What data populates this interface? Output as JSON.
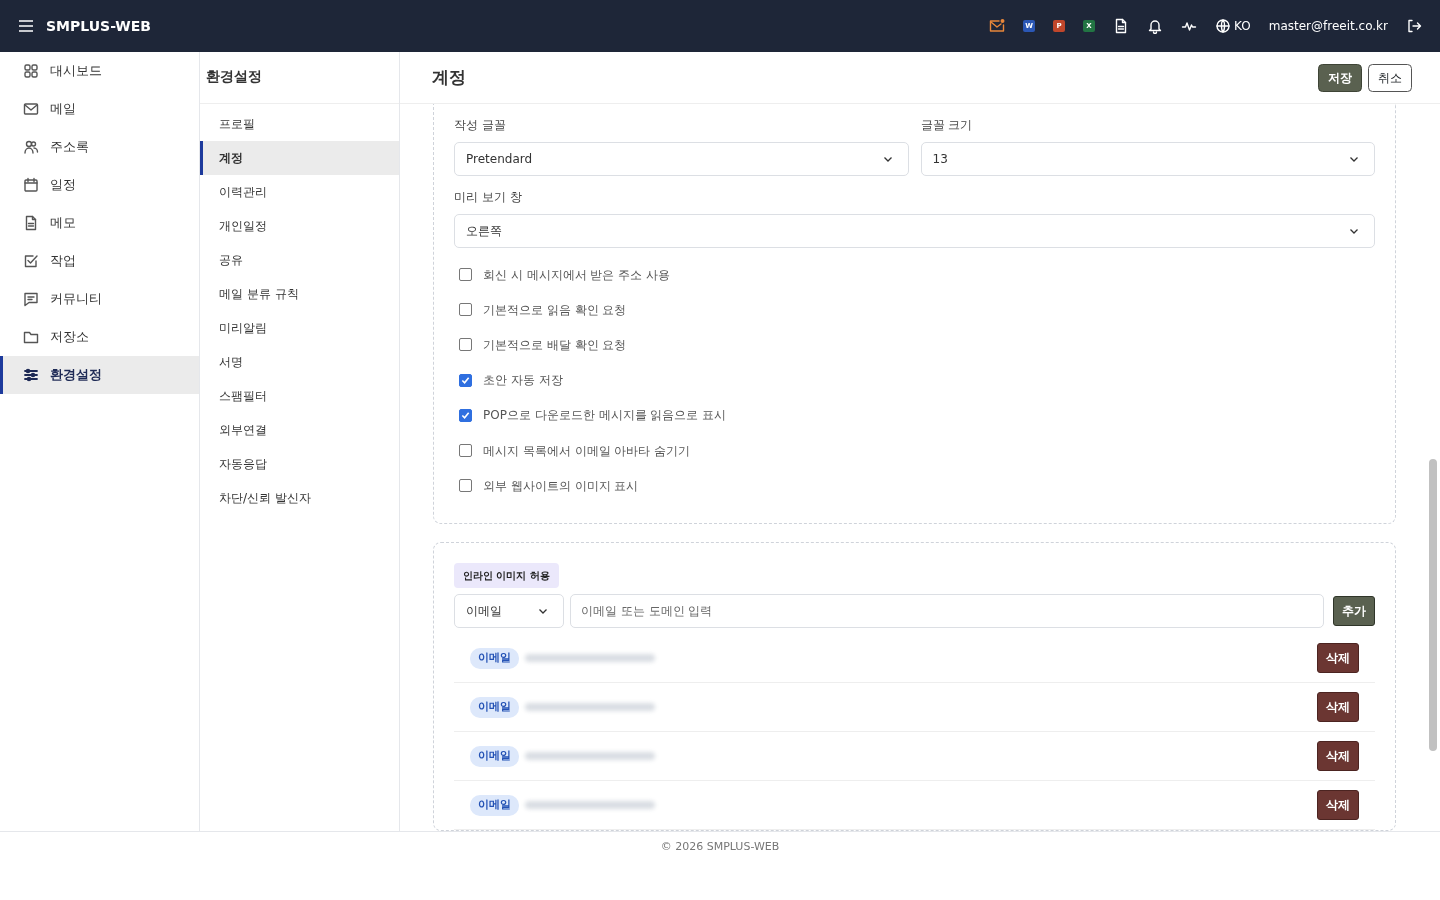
{
  "topbar": {
    "brand": "SMPLUS-WEB",
    "language": "KO",
    "user": "master@freeit.co.kr",
    "app_icons": [
      {
        "kind": "mail"
      },
      {
        "kind": "word",
        "letter": "W"
      },
      {
        "kind": "powerpoint",
        "letter": "P"
      },
      {
        "kind": "excel",
        "letter": "X"
      },
      {
        "kind": "document"
      },
      {
        "kind": "bell"
      },
      {
        "kind": "pulse"
      }
    ]
  },
  "sidebar": {
    "items": [
      {
        "label": "대시보드",
        "kind": "grid",
        "selected": false
      },
      {
        "label": "메일",
        "kind": "mail",
        "selected": false
      },
      {
        "label": "주소록",
        "kind": "people",
        "selected": false
      },
      {
        "label": "일정",
        "kind": "calendar",
        "selected": false
      },
      {
        "label": "메모",
        "kind": "document",
        "selected": false
      },
      {
        "label": "작업",
        "kind": "checkbox",
        "selected": false
      },
      {
        "label": "커뮤니티",
        "kind": "chat",
        "selected": false
      },
      {
        "label": "저장소",
        "kind": "folder",
        "selected": false
      },
      {
        "label": "환경설정",
        "kind": "sliders",
        "selected": true
      }
    ]
  },
  "submenu": {
    "title": "환경설정",
    "items": [
      {
        "label": "프로필",
        "selected": false
      },
      {
        "label": "계정",
        "selected": true
      },
      {
        "label": "이력관리",
        "selected": false
      },
      {
        "label": "개인일정",
        "selected": false
      },
      {
        "label": "공유",
        "selected": false
      },
      {
        "label": "메일 분류 규칙",
        "selected": false
      },
      {
        "label": "미리알림",
        "selected": false
      },
      {
        "label": "서명",
        "selected": false
      },
      {
        "label": "스팸필터",
        "selected": false
      },
      {
        "label": "외부연결",
        "selected": false
      },
      {
        "label": "자동응답",
        "selected": false
      },
      {
        "label": "차단/신뢰 발신자",
        "selected": false
      }
    ]
  },
  "page": {
    "title": "계정",
    "buttons": [
      {
        "label": "저장",
        "kind": "primary"
      },
      {
        "label": "취소",
        "kind": "outline"
      }
    ]
  },
  "compose": {
    "font_label": "작성 글꼴",
    "font_value": "Pretendard",
    "size_label": "글꼴 크기",
    "size_value": "13",
    "preview_label": "미리 보기 창",
    "preview_value": "오른쪽",
    "options": [
      {
        "label": "회신 시 메시지에서 받은 주소 사용",
        "checked": false
      },
      {
        "label": "기본적으로 읽음 확인 요청",
        "checked": false
      },
      {
        "label": "기본적으로 배달 확인 요청",
        "checked": false
      },
      {
        "label": "초안 자동 저장",
        "checked": true
      },
      {
        "label": "POP으로 다운로드한 메시지를 읽음으로 표시",
        "checked": true
      },
      {
        "label": "메시지 목록에서 이메일 아바타 숨기기",
        "checked": false
      },
      {
        "label": "외부 웹사이트의 이미지 표시",
        "checked": false
      }
    ]
  },
  "inline_images": {
    "tag": "인라인 이미지 허용",
    "type_value": "이메일",
    "input_placeholder": "이메일 또는 도메인 입력",
    "add_button": "추가",
    "entries": [
      {
        "type": "이메일",
        "delete": "삭제"
      },
      {
        "type": "이메일",
        "delete": "삭제"
      },
      {
        "type": "이메일",
        "delete": "삭제"
      },
      {
        "type": "이메일",
        "delete": "삭제"
      }
    ]
  },
  "footer": "© 2026 SMPLUS-WEB"
}
